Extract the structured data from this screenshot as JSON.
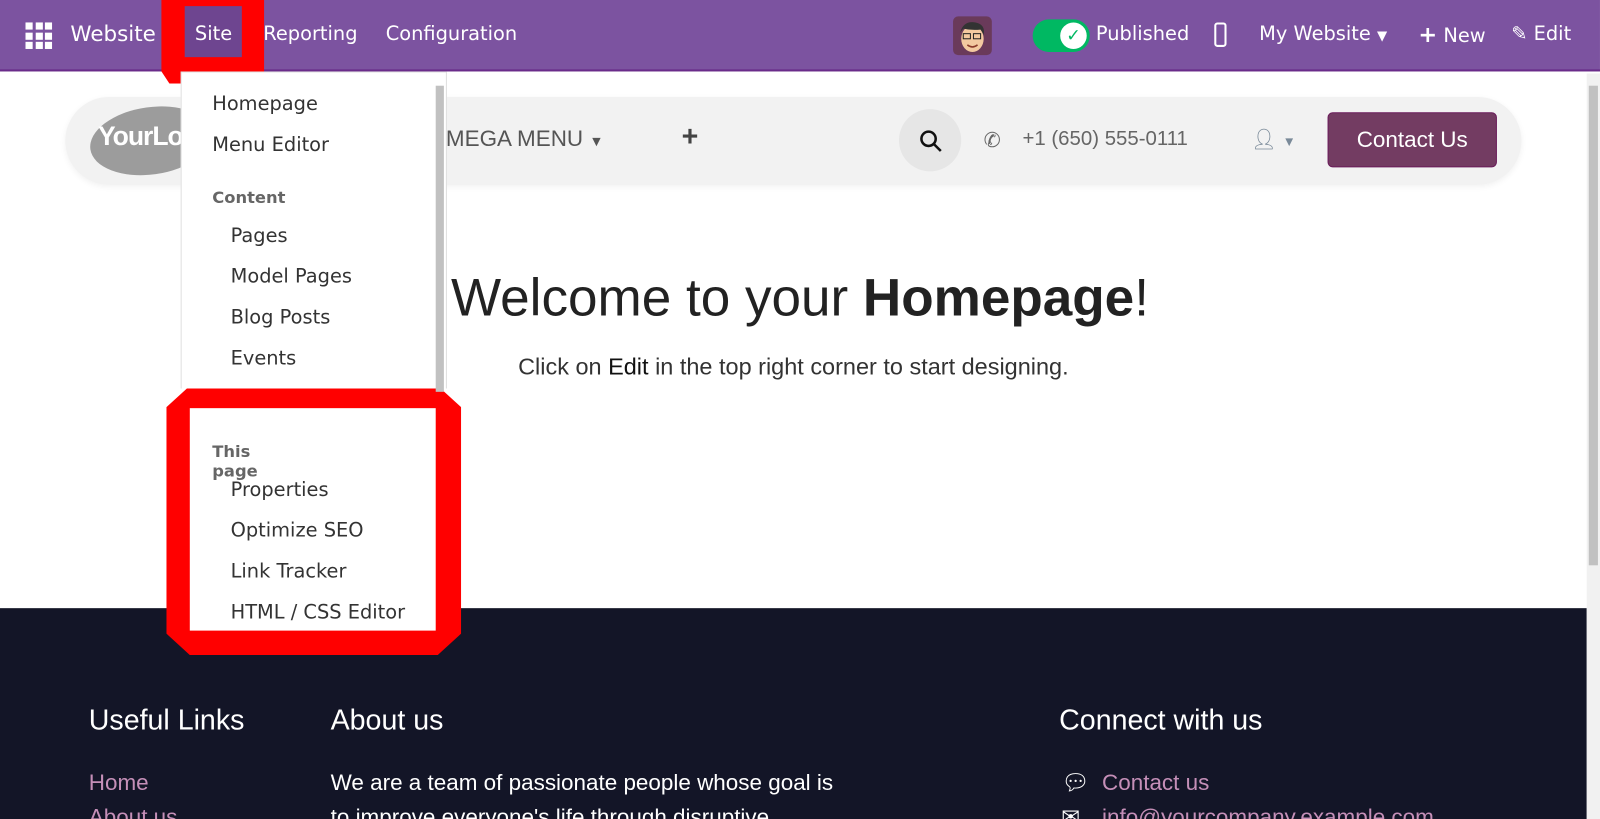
{
  "topbar": {
    "app_name": "Website",
    "menus": [
      "Site",
      "Reporting",
      "Configuration"
    ],
    "status": "Published",
    "website_selector": "My Website",
    "new_label": "New",
    "edit_label": "Edit",
    "accent": "#7c53a0"
  },
  "site_menu": {
    "items": [
      "Homepage",
      "Menu Editor"
    ],
    "content_header": "Content",
    "content_items": [
      "Pages",
      "Model Pages",
      "Blog Posts",
      "Events"
    ],
    "page_header": "This page",
    "page_items": [
      "Properties",
      "Optimize SEO",
      "Link Tracker",
      "HTML / CSS Editor"
    ]
  },
  "navbar": {
    "logo": "YourLogo",
    "mega_menu": "MEGA MENU",
    "phone": "+1 (650) 555-0111",
    "contact_button": "Contact Us"
  },
  "hero": {
    "title_prefix": "Welcome to your ",
    "title_bold": "Homepage",
    "title_suffix": "!",
    "sub_prefix": "Click on ",
    "sub_bold": "Edit",
    "sub_suffix": " in the top right corner to start designing."
  },
  "footer": {
    "useful_links_title": "Useful Links",
    "links": [
      "Home",
      "About us"
    ],
    "about_title": "About us",
    "about_text": [
      "We are a team of passionate people whose goal is",
      "to improve everyone's life through disruptive"
    ],
    "connect_title": "Connect with us",
    "connect": [
      "Contact us",
      "info@yourcompany.example.com"
    ]
  }
}
